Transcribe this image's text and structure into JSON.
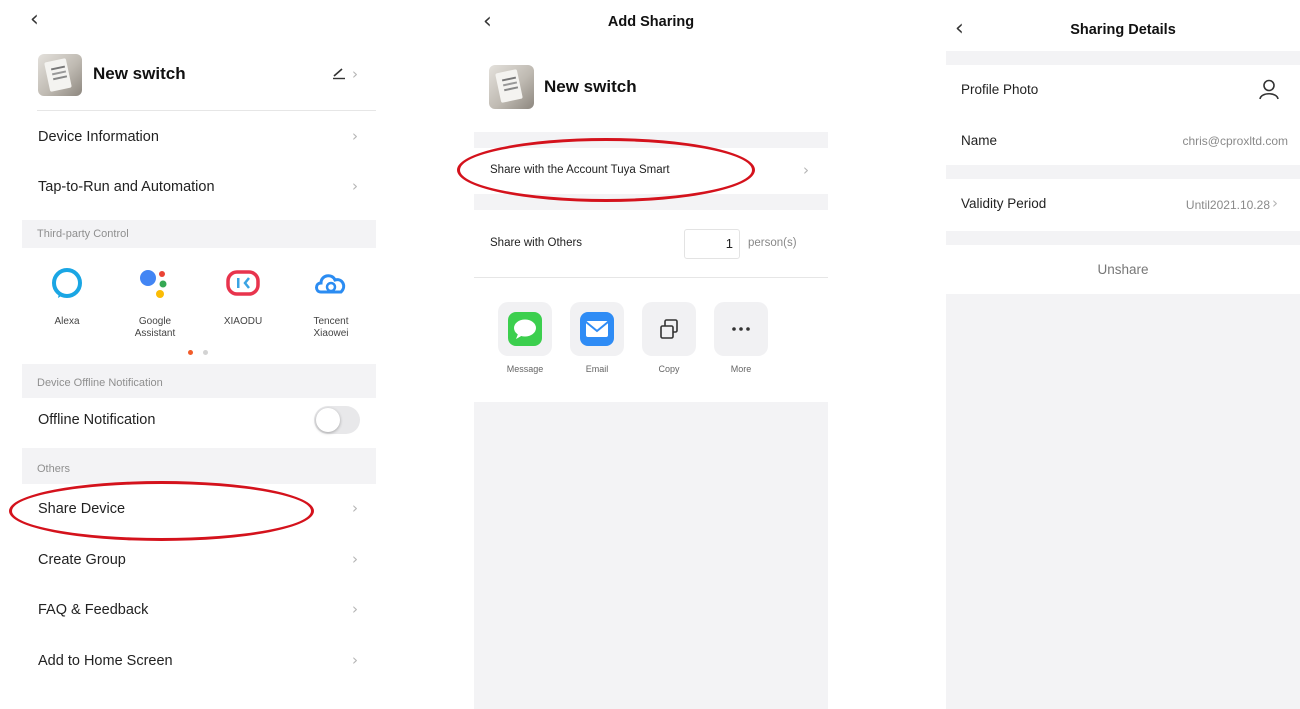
{
  "panel1": {
    "device_name": "New switch",
    "menu": [
      {
        "label": "Device Information"
      },
      {
        "label": "Tap-to-Run and Automation"
      }
    ],
    "third_party_section": "Third-party Control",
    "third_party": [
      {
        "label": "Alexa",
        "icon": "alexa-icon"
      },
      {
        "label": "Google\nAssistant",
        "icon": "google-assistant-icon"
      },
      {
        "label": "XIAODU",
        "icon": "xiaodu-icon"
      },
      {
        "label": "Tencent\nXiaowei",
        "icon": "tencent-xiaowei-icon"
      }
    ],
    "offline_section": "Device Offline Notification",
    "offline_label": "Offline Notification",
    "offline_enabled": false,
    "others_section": "Others",
    "others": [
      {
        "label": "Share Device"
      },
      {
        "label": "Create Group"
      },
      {
        "label": "FAQ & Feedback"
      },
      {
        "label": "Add to Home Screen"
      }
    ]
  },
  "panel2": {
    "title": "Add Sharing",
    "device_name": "New switch",
    "share_account": "Share with the Account Tuya Smart",
    "share_others": "Share with Others",
    "quantity": "1",
    "quantity_unit": "person(s)",
    "share_options": [
      {
        "label": "Message",
        "icon": "message-icon"
      },
      {
        "label": "Email",
        "icon": "email-icon"
      },
      {
        "label": "Copy",
        "icon": "copy-icon"
      },
      {
        "label": "More",
        "icon": "more-icon"
      }
    ]
  },
  "panel3": {
    "title": "Sharing Details",
    "profile_photo": "Profile Photo",
    "name_label": "Name",
    "name_value": "chris@cproxltd.com",
    "validity_label": "Validity Period",
    "validity_value": "Until2021.10.28",
    "unshare": "Unshare"
  },
  "colors": {
    "highlight": "#d4121c",
    "section_bg": "#f3f3f5",
    "dot_active": "#f25c2a"
  }
}
